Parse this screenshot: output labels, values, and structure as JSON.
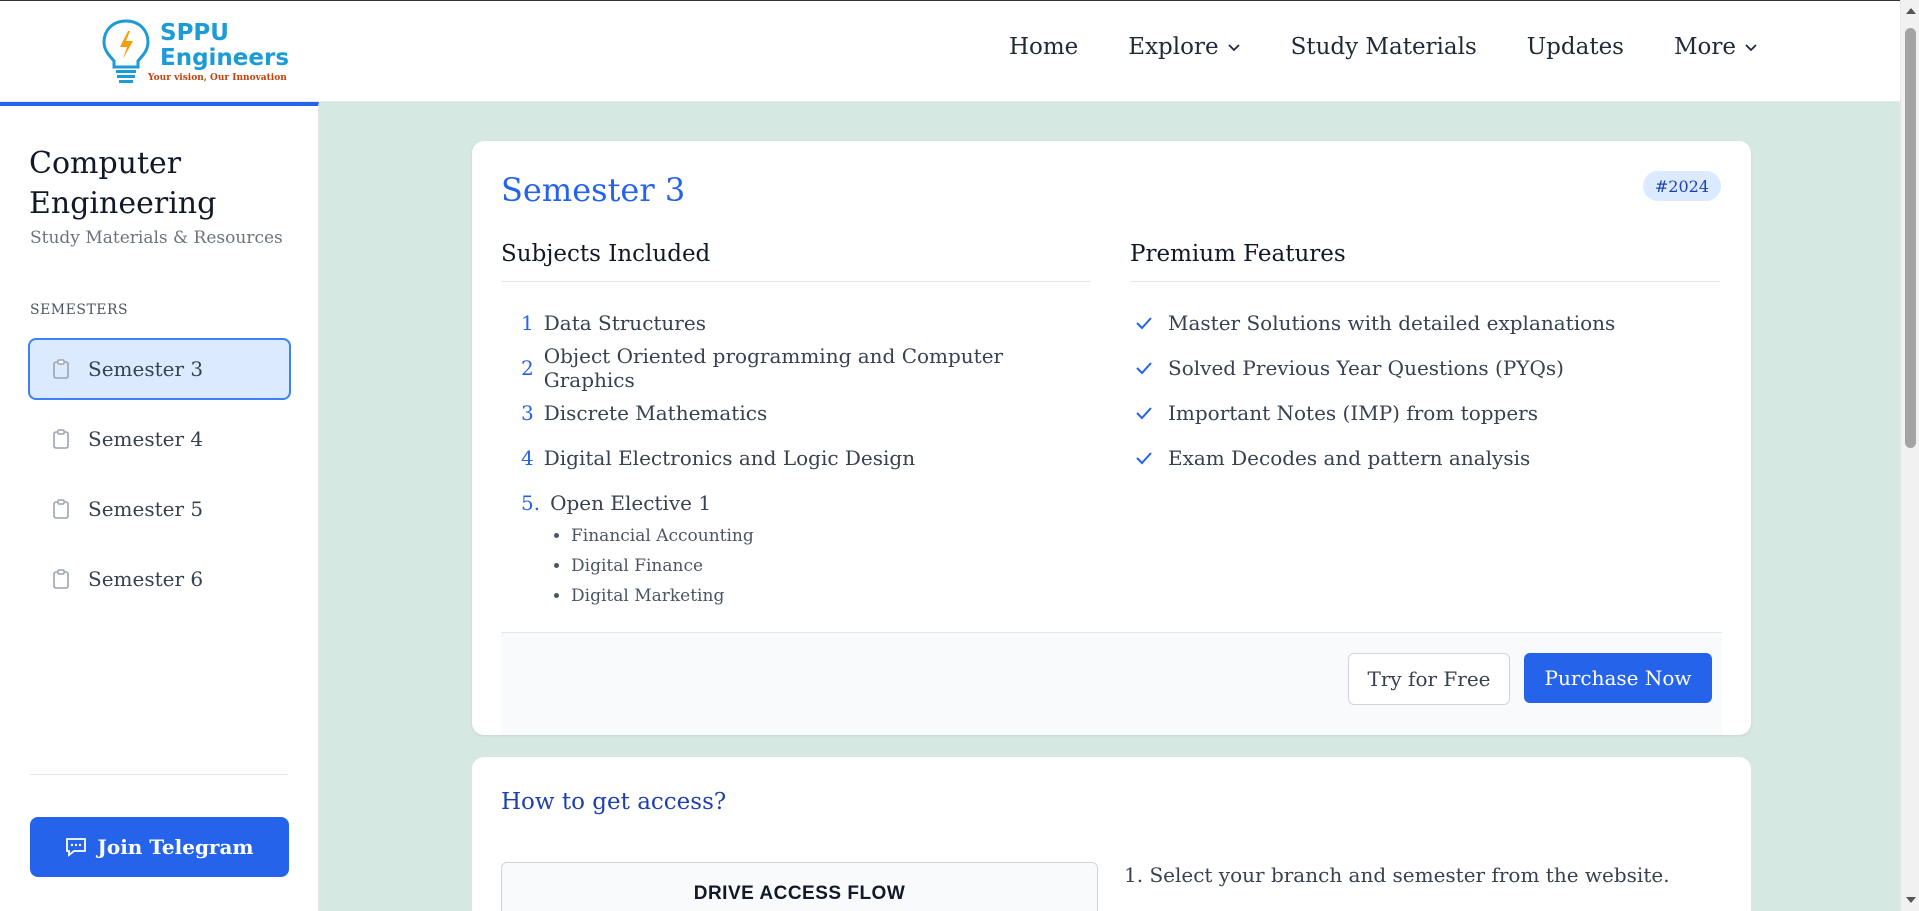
{
  "header": {
    "logo_title_line1": "SPPU",
    "logo_title_line2": "Engineers",
    "logo_tagline": "Your vision, Our Innovation",
    "nav": [
      {
        "label": "Home",
        "icon": ""
      },
      {
        "label": "Explore",
        "icon": "chevron-down-icon"
      },
      {
        "label": "Study Materials",
        "icon": ""
      },
      {
        "label": "Updates",
        "icon": ""
      },
      {
        "label": "More",
        "icon": "chevron-down-icon"
      }
    ]
  },
  "sidebar": {
    "title": "Computer Engineering",
    "subtitle": "Study Materials & Resources",
    "section_label": "SEMESTERS",
    "items": [
      {
        "label": "Semester 3",
        "active": true
      },
      {
        "label": "Semester 4",
        "active": false
      },
      {
        "label": "Semester 5",
        "active": false
      },
      {
        "label": "Semester 6",
        "active": false
      }
    ],
    "telegram_label": "Join Telegram"
  },
  "card": {
    "title": "Semester 3",
    "badge": "#2024",
    "subjects_heading": "Subjects Included",
    "subjects": [
      {
        "num": "1",
        "name": "Data Structures"
      },
      {
        "num": "2",
        "name": "Object Oriented programming and Computer Graphics"
      },
      {
        "num": "3",
        "name": "Discrete Mathematics"
      },
      {
        "num": "4",
        "name": "Digital Electronics and Logic Design"
      },
      {
        "num": "5.",
        "name": "Open Elective 1"
      }
    ],
    "electives": [
      "Financial Accounting",
      "Digital Finance",
      "Digital Marketing"
    ],
    "features_heading": "Premium Features",
    "features": [
      "Master Solutions with detailed explanations",
      "Solved Previous Year Questions (PYQs)",
      "Important Notes (IMP) from toppers",
      "Exam Decodes and pattern analysis"
    ],
    "try_label": "Try for Free",
    "buy_label": "Purchase Now"
  },
  "access": {
    "title": "How to get access?",
    "flow_title": "DRIVE ACCESS FLOW",
    "step1": "1. Select your branch and semester from the website."
  },
  "colors": {
    "accent": "#2563eb",
    "background": "#d6e8e2"
  }
}
